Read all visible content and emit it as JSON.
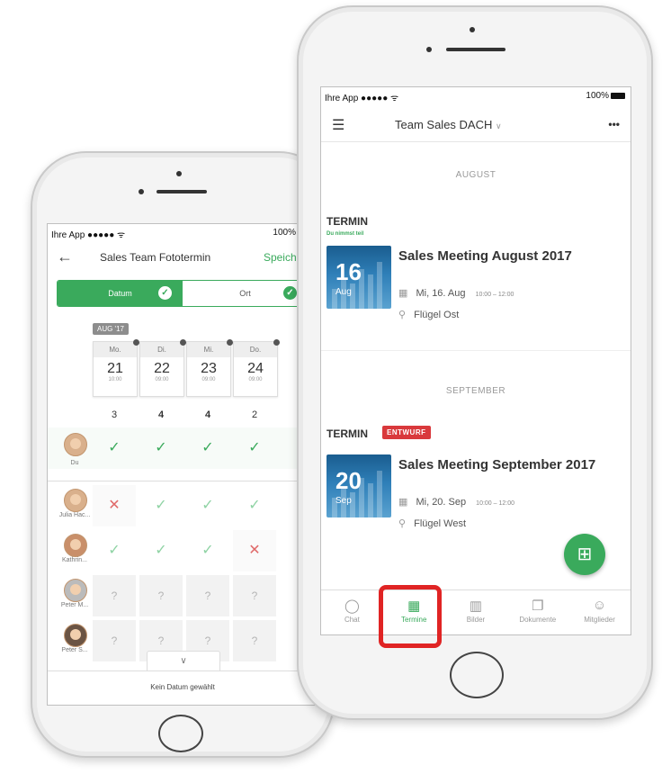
{
  "left_phone": {
    "status": {
      "carrier": "Ihre App  ●●●●● ᯤ",
      "battery": "100%"
    },
    "header": {
      "back_icon": "arrow-left",
      "title": "Sales Team Fototermin",
      "save": "Speichern"
    },
    "toggle": {
      "left": "Datum",
      "right": "Ort"
    },
    "month_badge": "AUG '17",
    "days": [
      {
        "weekday": "Mo.",
        "day": "21",
        "time": "10:00"
      },
      {
        "weekday": "Di.",
        "day": "22",
        "time": "09:00"
      },
      {
        "weekday": "Mi.",
        "day": "23",
        "time": "09:00"
      },
      {
        "weekday": "Do.",
        "day": "24",
        "time": "09:00"
      }
    ],
    "counts": [
      "3",
      "4",
      "4",
      "2"
    ],
    "voters": [
      {
        "name": "Du",
        "votes": [
          "✓",
          "✓",
          "✓",
          "✓"
        ]
      },
      {
        "name": "Julia Hac...",
        "votes": [
          "✕",
          "✓",
          "✓",
          "✓"
        ]
      },
      {
        "name": "Kathrin...",
        "votes": [
          "✓",
          "✓",
          "✓",
          "✕"
        ]
      },
      {
        "name": "Peter M...",
        "votes": [
          "?",
          "?",
          "?",
          "?"
        ]
      },
      {
        "name": "Peter S...",
        "votes": [
          "?",
          "?",
          "?",
          "?"
        ]
      }
    ],
    "footer": "Kein Datum gewählt"
  },
  "right_phone": {
    "status": {
      "carrier": "Ihre App  ●●●●● ᯤ",
      "battery": "100%"
    },
    "header": {
      "title": "Team Sales DACH",
      "more": "•••"
    },
    "sections": [
      {
        "month": "AUGUST",
        "label": "TERMIN",
        "sub": "Du nimmst teil",
        "badge": "",
        "thumb_day": "16",
        "thumb_month": "Aug",
        "title": "Sales Meeting August 2017",
        "date": "Mi, 16. Aug",
        "time": "10:00 – 12:00",
        "place": "Flügel Ost"
      },
      {
        "month": "SEPTEMBER",
        "label": "TERMIN",
        "sub": "",
        "badge": "ENTWURF",
        "thumb_day": "20",
        "thumb_month": "Sep",
        "title": "Sales Meeting September 2017",
        "date": "Mi, 20. Sep",
        "time": "10:00 – 12:00",
        "place": "Flügel West"
      }
    ],
    "tabs": [
      {
        "label": "Chat",
        "icon": "chat-bubble"
      },
      {
        "label": "Termine",
        "icon": "calendar"
      },
      {
        "label": "Bilder",
        "icon": "image"
      },
      {
        "label": "Dokumente",
        "icon": "documents"
      },
      {
        "label": "Mitglieder",
        "icon": "person"
      }
    ],
    "colors": {
      "accent": "#3aaa5c",
      "draft": "#d9393c",
      "highlight": "#e02424"
    }
  }
}
